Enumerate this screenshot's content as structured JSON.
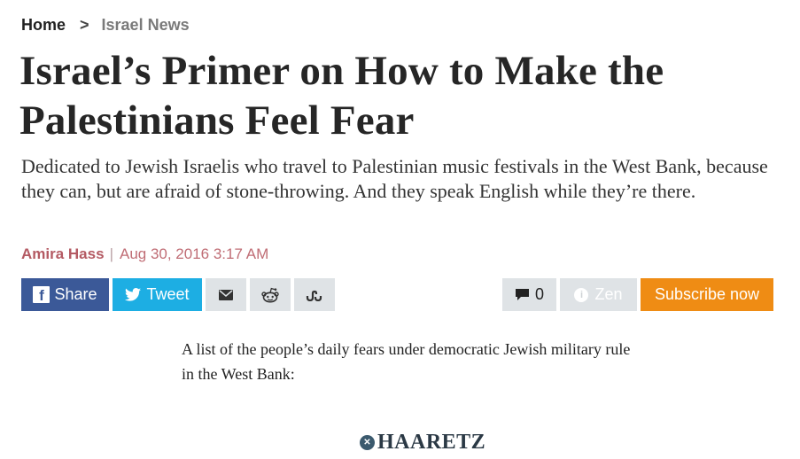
{
  "breadcrumb": {
    "home": "Home",
    "separator": ">",
    "section": "Israel News"
  },
  "article": {
    "headline": "Israel’s Primer on How to Make the Palestinians Feel Fear",
    "subtitle": "Dedicated to Jewish Israelis who travel to Palestinian music festivals in the West Bank, because they can, but are afraid of stone-throwing. And they speak English while they’re there.",
    "author": "Amira Hass",
    "byline_separator": "|",
    "date": "Aug 30, 2016 3:17 AM",
    "body_intro": "A list of the people’s daily fears under democratic Jewish military rule in the West Bank:"
  },
  "share_bar": {
    "facebook_label": "Share",
    "twitter_label": "Tweet",
    "email_icon": "envelope-icon",
    "reddit_icon": "reddit-icon",
    "stumbleupon_icon": "stumbleupon-icon",
    "comments_count": "0",
    "zen_label": "Zen",
    "subscribe_label": "Subscribe now"
  },
  "footer": {
    "logo_text": "HAARETZ"
  },
  "colors": {
    "facebook": "#3b5998",
    "twitter": "#1daee3",
    "subscribe": "#ef8c14",
    "author": "#b45a63",
    "icon_button_bg": "#dfe3e6"
  }
}
